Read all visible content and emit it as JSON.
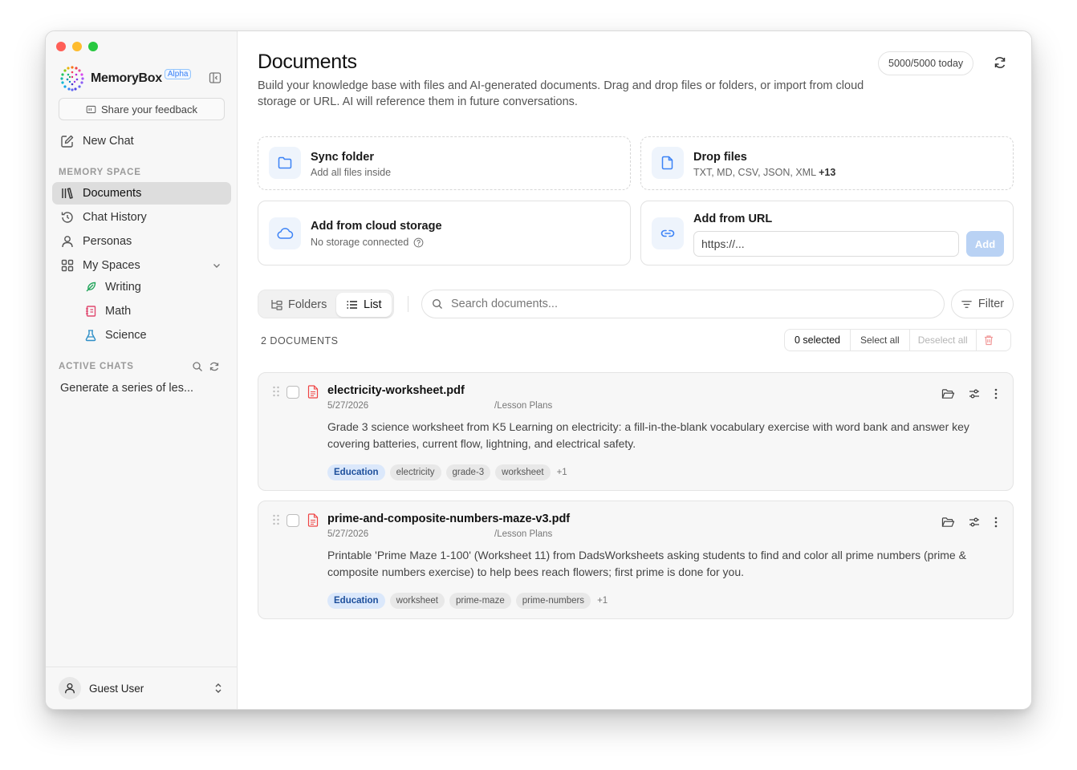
{
  "app": {
    "brand": "MemoryBox",
    "badge": "Alpha"
  },
  "sidebar": {
    "feedback_label": "Share your feedback",
    "new_chat_label": "New Chat",
    "memory_space_label": "MEMORY SPACE",
    "items": [
      {
        "label": "Documents",
        "icon": "library-icon",
        "active": true
      },
      {
        "label": "Chat History",
        "icon": "history-icon"
      },
      {
        "label": "Personas",
        "icon": "user-icon"
      },
      {
        "label": "My Spaces",
        "icon": "grid-icon"
      }
    ],
    "spaces": [
      {
        "label": "Writing",
        "icon": "feather-icon",
        "color": "#22a55b"
      },
      {
        "label": "Math",
        "icon": "notebook-icon",
        "color": "#e0486f"
      },
      {
        "label": "Science",
        "icon": "flask-icon",
        "color": "#2f8fc7"
      }
    ],
    "active_chats_label": "ACTIVE CHATS",
    "active_chats": [
      "Generate a series of les..."
    ],
    "user_name": "Guest User"
  },
  "main": {
    "title": "Documents",
    "description": "Build your knowledge base with files and AI-generated documents. Drag and drop files or folders, or import from cloud storage or URL. AI will reference them in future conversations.",
    "quota": "5000/5000 today",
    "cards": {
      "sync": {
        "title": "Sync folder",
        "subtitle": "Add all files inside"
      },
      "drop": {
        "title": "Drop files",
        "subtitle": "TXT, MD, CSV, JSON, XML",
        "more": "+13"
      },
      "cloud": {
        "title": "Add from cloud storage",
        "subtitle": "No storage connected"
      },
      "url": {
        "title": "Add from URL",
        "placeholder": "https://...",
        "button": "Add"
      }
    },
    "view_toggle": {
      "folders": "Folders",
      "list": "List",
      "active": "list"
    },
    "search_placeholder": "Search documents...",
    "filter_label": "Filter",
    "count_label": "2 DOCUMENTS",
    "selection": {
      "count": "0 selected",
      "select_all": "Select all",
      "deselect_all": "Deselect all"
    },
    "documents": [
      {
        "name": "electricity-worksheet.pdf",
        "date": "5/27/2026",
        "folder": "/Lesson Plans",
        "summary": "Grade 3 science worksheet from K5 Learning on electricity: a fill-in-the-blank vocabulary exercise with word bank and answer key covering batteries, current flow, lightning, and electrical safety.",
        "tags": [
          "Education",
          "electricity",
          "grade-3",
          "worksheet"
        ],
        "more_tags": "+1"
      },
      {
        "name": "prime-and-composite-numbers-maze-v3.pdf",
        "date": "5/27/2026",
        "folder": "/Lesson Plans",
        "summary": "Printable 'Prime Maze 1-100' (Worksheet 11) from DadsWorksheets asking students to find and color all prime numbers (prime & composite numbers exercise) to help bees reach flowers; first prime is done for you.",
        "tags": [
          "Education",
          "worksheet",
          "prime-maze",
          "prime-numbers"
        ],
        "more_tags": "+1"
      }
    ]
  },
  "colors": {
    "accent": "#3b82f6",
    "active_nav": "#dddddd",
    "tag_education": "#dbe8fb"
  }
}
